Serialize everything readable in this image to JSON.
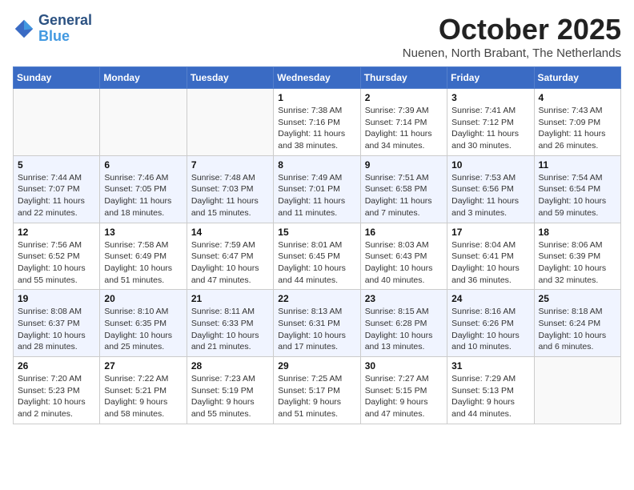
{
  "header": {
    "logo_line1": "General",
    "logo_line2": "Blue",
    "month": "October 2025",
    "location": "Nuenen, North Brabant, The Netherlands"
  },
  "weekdays": [
    "Sunday",
    "Monday",
    "Tuesday",
    "Wednesday",
    "Thursday",
    "Friday",
    "Saturday"
  ],
  "weeks": [
    [
      {
        "day": "",
        "info": ""
      },
      {
        "day": "",
        "info": ""
      },
      {
        "day": "",
        "info": ""
      },
      {
        "day": "1",
        "info": "Sunrise: 7:38 AM\nSunset: 7:16 PM\nDaylight: 11 hours\nand 38 minutes."
      },
      {
        "day": "2",
        "info": "Sunrise: 7:39 AM\nSunset: 7:14 PM\nDaylight: 11 hours\nand 34 minutes."
      },
      {
        "day": "3",
        "info": "Sunrise: 7:41 AM\nSunset: 7:12 PM\nDaylight: 11 hours\nand 30 minutes."
      },
      {
        "day": "4",
        "info": "Sunrise: 7:43 AM\nSunset: 7:09 PM\nDaylight: 11 hours\nand 26 minutes."
      }
    ],
    [
      {
        "day": "5",
        "info": "Sunrise: 7:44 AM\nSunset: 7:07 PM\nDaylight: 11 hours\nand 22 minutes."
      },
      {
        "day": "6",
        "info": "Sunrise: 7:46 AM\nSunset: 7:05 PM\nDaylight: 11 hours\nand 18 minutes."
      },
      {
        "day": "7",
        "info": "Sunrise: 7:48 AM\nSunset: 7:03 PM\nDaylight: 11 hours\nand 15 minutes."
      },
      {
        "day": "8",
        "info": "Sunrise: 7:49 AM\nSunset: 7:01 PM\nDaylight: 11 hours\nand 11 minutes."
      },
      {
        "day": "9",
        "info": "Sunrise: 7:51 AM\nSunset: 6:58 PM\nDaylight: 11 hours\nand 7 minutes."
      },
      {
        "day": "10",
        "info": "Sunrise: 7:53 AM\nSunset: 6:56 PM\nDaylight: 11 hours\nand 3 minutes."
      },
      {
        "day": "11",
        "info": "Sunrise: 7:54 AM\nSunset: 6:54 PM\nDaylight: 10 hours\nand 59 minutes."
      }
    ],
    [
      {
        "day": "12",
        "info": "Sunrise: 7:56 AM\nSunset: 6:52 PM\nDaylight: 10 hours\nand 55 minutes."
      },
      {
        "day": "13",
        "info": "Sunrise: 7:58 AM\nSunset: 6:49 PM\nDaylight: 10 hours\nand 51 minutes."
      },
      {
        "day": "14",
        "info": "Sunrise: 7:59 AM\nSunset: 6:47 PM\nDaylight: 10 hours\nand 47 minutes."
      },
      {
        "day": "15",
        "info": "Sunrise: 8:01 AM\nSunset: 6:45 PM\nDaylight: 10 hours\nand 44 minutes."
      },
      {
        "day": "16",
        "info": "Sunrise: 8:03 AM\nSunset: 6:43 PM\nDaylight: 10 hours\nand 40 minutes."
      },
      {
        "day": "17",
        "info": "Sunrise: 8:04 AM\nSunset: 6:41 PM\nDaylight: 10 hours\nand 36 minutes."
      },
      {
        "day": "18",
        "info": "Sunrise: 8:06 AM\nSunset: 6:39 PM\nDaylight: 10 hours\nand 32 minutes."
      }
    ],
    [
      {
        "day": "19",
        "info": "Sunrise: 8:08 AM\nSunset: 6:37 PM\nDaylight: 10 hours\nand 28 minutes."
      },
      {
        "day": "20",
        "info": "Sunrise: 8:10 AM\nSunset: 6:35 PM\nDaylight: 10 hours\nand 25 minutes."
      },
      {
        "day": "21",
        "info": "Sunrise: 8:11 AM\nSunset: 6:33 PM\nDaylight: 10 hours\nand 21 minutes."
      },
      {
        "day": "22",
        "info": "Sunrise: 8:13 AM\nSunset: 6:31 PM\nDaylight: 10 hours\nand 17 minutes."
      },
      {
        "day": "23",
        "info": "Sunrise: 8:15 AM\nSunset: 6:28 PM\nDaylight: 10 hours\nand 13 minutes."
      },
      {
        "day": "24",
        "info": "Sunrise: 8:16 AM\nSunset: 6:26 PM\nDaylight: 10 hours\nand 10 minutes."
      },
      {
        "day": "25",
        "info": "Sunrise: 8:18 AM\nSunset: 6:24 PM\nDaylight: 10 hours\nand 6 minutes."
      }
    ],
    [
      {
        "day": "26",
        "info": "Sunrise: 7:20 AM\nSunset: 5:23 PM\nDaylight: 10 hours\nand 2 minutes."
      },
      {
        "day": "27",
        "info": "Sunrise: 7:22 AM\nSunset: 5:21 PM\nDaylight: 9 hours\nand 58 minutes."
      },
      {
        "day": "28",
        "info": "Sunrise: 7:23 AM\nSunset: 5:19 PM\nDaylight: 9 hours\nand 55 minutes."
      },
      {
        "day": "29",
        "info": "Sunrise: 7:25 AM\nSunset: 5:17 PM\nDaylight: 9 hours\nand 51 minutes."
      },
      {
        "day": "30",
        "info": "Sunrise: 7:27 AM\nSunset: 5:15 PM\nDaylight: 9 hours\nand 47 minutes."
      },
      {
        "day": "31",
        "info": "Sunrise: 7:29 AM\nSunset: 5:13 PM\nDaylight: 9 hours\nand 44 minutes."
      },
      {
        "day": "",
        "info": ""
      }
    ]
  ]
}
